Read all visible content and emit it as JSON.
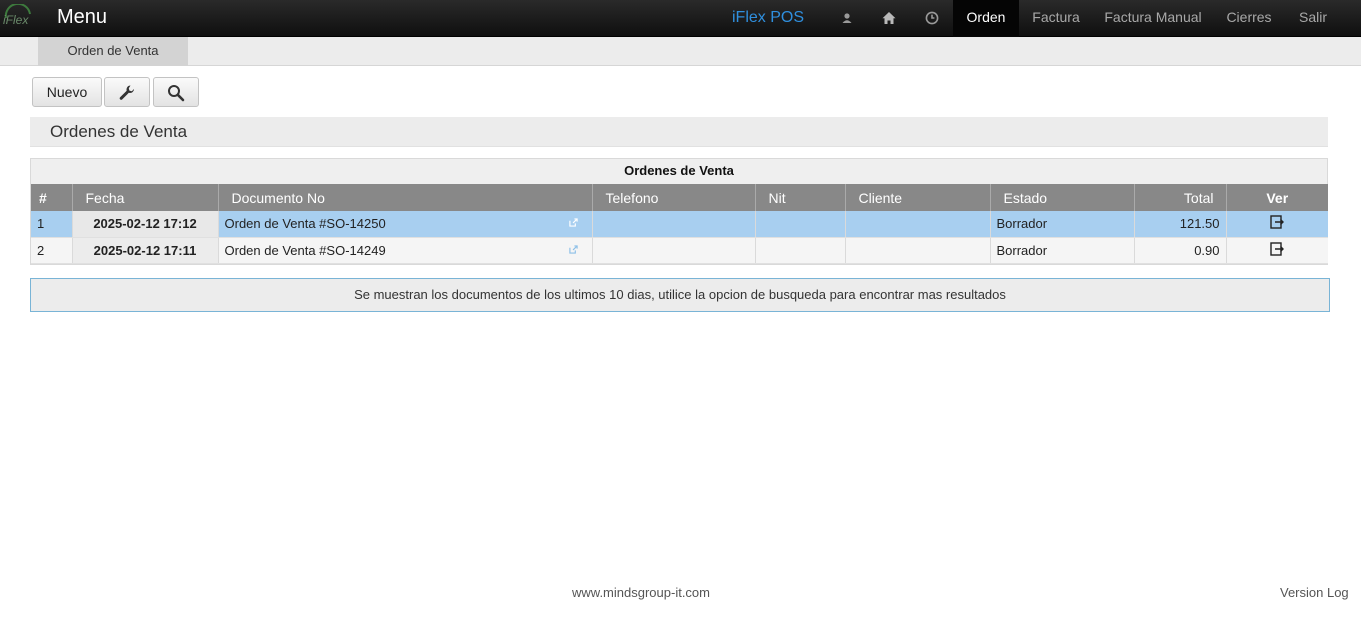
{
  "header": {
    "logo_text": "iFlex",
    "menu_label": "Menu",
    "brand": "iFlex POS",
    "icons": [
      "user-icon",
      "home-icon",
      "clock-icon"
    ],
    "nav": [
      {
        "label": "Orden",
        "active": true
      },
      {
        "label": "Factura",
        "active": false
      },
      {
        "label": "Factura Manual",
        "active": false
      },
      {
        "label": "Cierres",
        "active": false
      },
      {
        "label": "Salir",
        "active": false
      }
    ]
  },
  "subnav": {
    "tab": "Orden de Venta"
  },
  "toolbar": {
    "new_label": "Nuevo",
    "icons": [
      "wrench-icon",
      "search-icon"
    ]
  },
  "section": {
    "title": "Ordenes de Venta"
  },
  "table": {
    "caption": "Ordenes de Venta",
    "columns": [
      "#",
      "Fecha",
      "Documento No",
      "Telefono",
      "Nit",
      "Cliente",
      "Estado",
      "Total",
      "Ver"
    ],
    "rows": [
      {
        "num": "1",
        "fecha": "2025-02-12 17:12",
        "documento": "Orden de Venta #SO-14250",
        "telefono": "",
        "nit": "",
        "cliente": "",
        "estado": "Borrador",
        "total": "121.50",
        "selected": true
      },
      {
        "num": "2",
        "fecha": "2025-02-12 17:11",
        "documento": "Orden de Venta #SO-14249",
        "telefono": "",
        "nit": "",
        "cliente": "",
        "estado": "Borrador",
        "total": "0.90",
        "selected": false
      }
    ]
  },
  "info_message": "Se muestran los documentos de los ultimos 10 dias, utilice la opcion de busqueda para encontrar mas resultados",
  "footer": {
    "website": "www.mindsgroup-it.com",
    "version_log": "Version Log"
  },
  "colors": {
    "brand": "#2f8fde",
    "selected_row": "#a8cff0",
    "header_bg": "#888888"
  }
}
